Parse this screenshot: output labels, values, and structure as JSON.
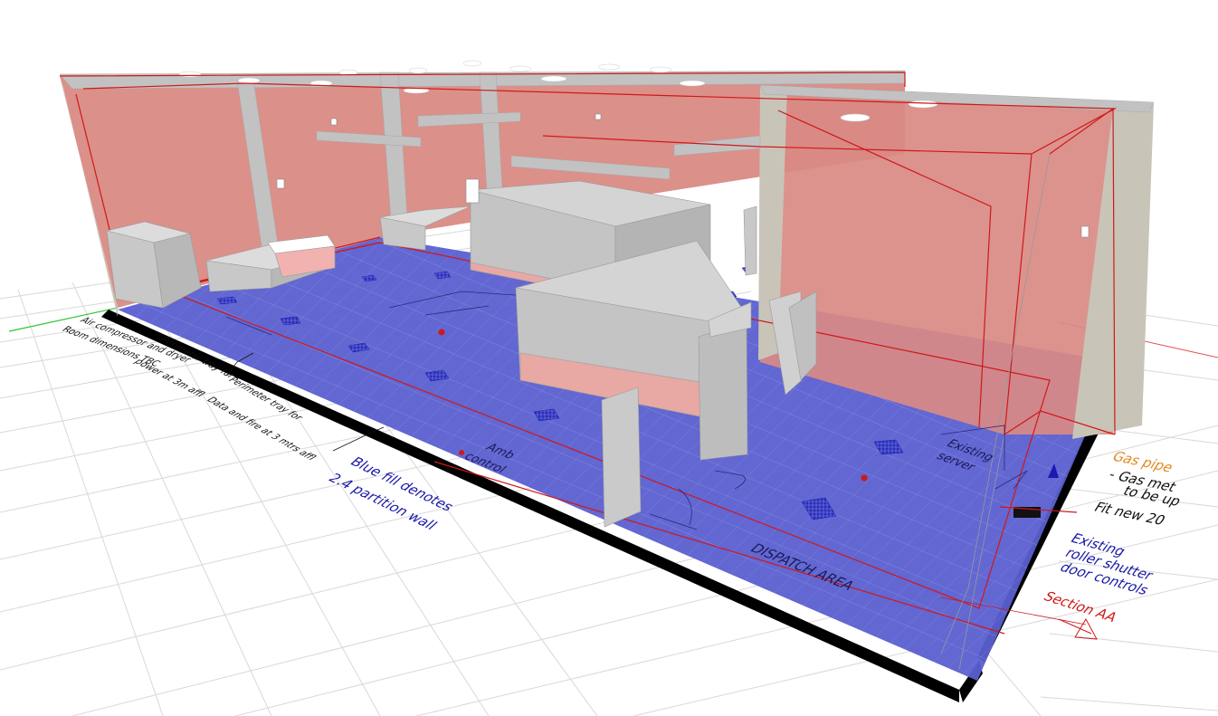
{
  "colors": {
    "background": "#ffffff",
    "grid": "#d6d6d6",
    "floor_fill": "#5a5fd0",
    "wall_fill": "#d98a84",
    "wall_outline": "#d01818",
    "structure": "#c9c4b8",
    "equipment": "#c9c9c9",
    "black_edge": "#000000",
    "note_blue": "#1a1aa8",
    "note_red": "#d01818",
    "note_orange": "#e08a20",
    "note_black": "#111111"
  },
  "annotations": {
    "note_black_1": "Air compressor and dryer",
    "note_black_2": "Room dimensions TBC",
    "note_black_3": "Perimeter tray for",
    "note_black_4": "power at 3m affl",
    "note_black_5": "Perimeter tray for",
    "note_black_6": "Data and fire at 3 mtrs affl",
    "blue_fill_1": "Blue fill denotes",
    "blue_fill_2": "2.4 partition wall",
    "amb_1": "Amb",
    "amb_2": "control",
    "existing_server_1": "Existing",
    "existing_server_2": "server",
    "dispatch": "DISPATCH   AREA",
    "gas_pipe": "Gas pipe",
    "gas_meter_1": "- Gas met",
    "gas_meter_2": "to be up",
    "fit_new": "Fit new 20",
    "roller_1": "Existing",
    "roller_2": "roller shutter",
    "roller_3": "door controls",
    "section": "Section AA"
  }
}
